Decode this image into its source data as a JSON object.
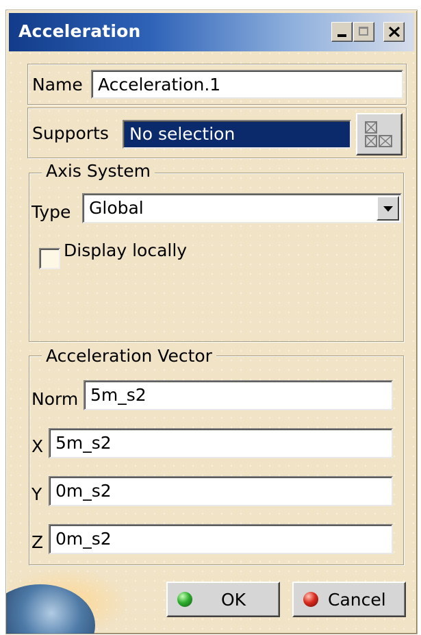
{
  "window": {
    "title": "Acceleration"
  },
  "name_row": {
    "label": "Name",
    "value": "Acceleration.1"
  },
  "supports_row": {
    "label": "Supports",
    "value": "No selection"
  },
  "axis_system": {
    "legend": "Axis System",
    "type_label": "Type",
    "type_value": "Global",
    "display_locally_label": "Display locally",
    "display_locally_checked": false
  },
  "acceleration_vector": {
    "legend": "Acceleration Vector",
    "norm_label": "Norm",
    "norm_value": "5m_s2",
    "x_label": "X",
    "x_value": "5m_s2",
    "y_label": "Y",
    "y_value": "0m_s2",
    "z_label": "Z",
    "z_value": "0m_s2"
  },
  "buttons": {
    "ok_label": "OK",
    "cancel_label": "Cancel"
  },
  "colors": {
    "title_bar": "#123c8a",
    "dialog_bg": "#f1e3c6",
    "selection_bg": "#0a2a6b",
    "ok_icon": "#2fae2f",
    "cancel_icon": "#d92a1c"
  },
  "icons": [
    "minimize-icon",
    "maximize-icon",
    "close-icon",
    "multi-selection-icon",
    "ok-ball-icon",
    "cancel-ball-icon"
  ]
}
